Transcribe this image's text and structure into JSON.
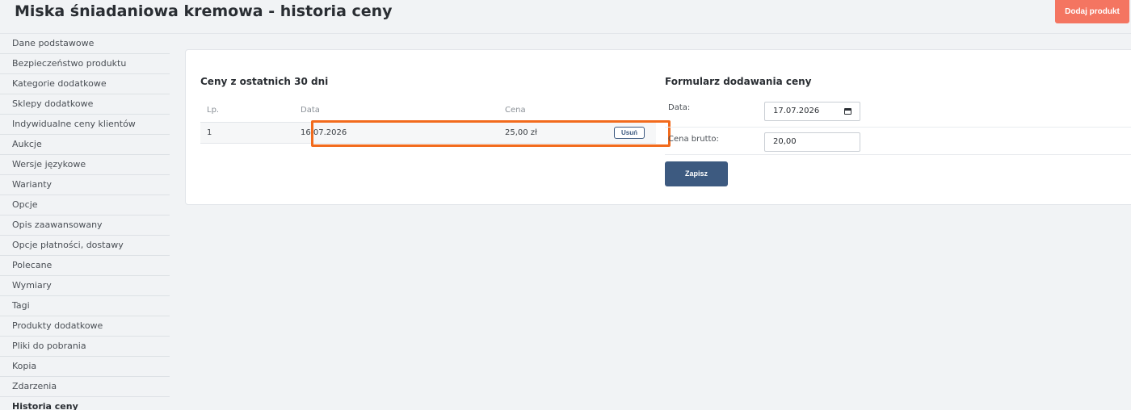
{
  "header": {
    "title": "Miska śniadaniowa kremowa - historia ceny",
    "add_product_label": "Dodaj produkt"
  },
  "sidebar": {
    "items": [
      {
        "label": "Dane podstawowe"
      },
      {
        "label": "Bezpieczeństwo produktu"
      },
      {
        "label": "Kategorie dodatkowe"
      },
      {
        "label": "Sklepy dodatkowe"
      },
      {
        "label": "Indywidualne ceny klientów"
      },
      {
        "label": "Aukcje"
      },
      {
        "label": "Wersje językowe"
      },
      {
        "label": "Warianty"
      },
      {
        "label": "Opcje"
      },
      {
        "label": "Opis zaawansowany"
      },
      {
        "label": "Opcje płatności, dostawy"
      },
      {
        "label": "Polecane"
      },
      {
        "label": "Wymiary"
      },
      {
        "label": "Tagi"
      },
      {
        "label": "Produkty dodatkowe"
      },
      {
        "label": "Pliki do pobrania"
      },
      {
        "label": "Kopia"
      },
      {
        "label": "Zdarzenia"
      },
      {
        "label": "Historia ceny",
        "active": true
      }
    ]
  },
  "prices": {
    "title": "Ceny z ostatnich 30 dni",
    "columns": {
      "lp": "Lp.",
      "date": "Data",
      "price": "Cena"
    },
    "rows": [
      {
        "lp": "1",
        "date": "16.07.2026",
        "price": "25,00 zł",
        "delete_label": "Usuń"
      }
    ]
  },
  "form": {
    "title": "Formularz dodawania ceny",
    "date_label": "Data:",
    "date_value": "17.07.2026",
    "price_label": "Cena brutto:",
    "price_value": "20,00",
    "save_label": "Zapisz"
  },
  "colors": {
    "accent": "#f47561",
    "primary": "#3d5a80",
    "highlight": "#f26b1d"
  }
}
